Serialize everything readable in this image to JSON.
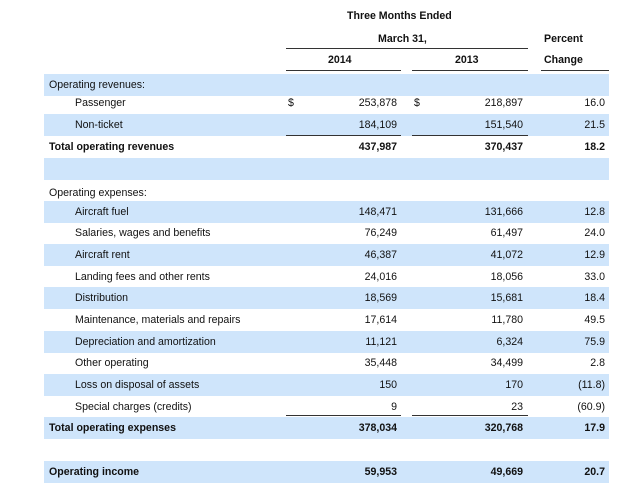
{
  "header": {
    "period_line1": "Three Months Ended",
    "period_line2": "March 31,",
    "col_2014": "2014",
    "col_2013": "2013",
    "pct_line1": "Percent",
    "pct_line2": "Change"
  },
  "rows": [
    {
      "label": "Operating revenues:",
      "indent": false,
      "bold": false,
      "shade": true,
      "dollar14": "",
      "dollar13": "",
      "v2014": "",
      "v2013": "",
      "pct": ""
    },
    {
      "label": "Passenger",
      "indent": true,
      "bold": false,
      "shade": false,
      "dollar14": "$",
      "dollar13": "$",
      "v2014": "253,878",
      "v2013": "218,897",
      "pct": "16.0"
    },
    {
      "label": "Non-ticket",
      "indent": true,
      "bold": false,
      "shade": true,
      "dollar14": "",
      "dollar13": "",
      "v2014": "184,109",
      "v2013": "151,540",
      "pct": "21.5"
    },
    {
      "label": "Total operating revenues",
      "indent": false,
      "bold": true,
      "shade": false,
      "dollar14": "",
      "dollar13": "",
      "v2014": "437,987",
      "v2013": "370,437",
      "pct": "18.2"
    },
    {
      "label": "",
      "indent": false,
      "bold": false,
      "shade": true,
      "dollar14": "",
      "dollar13": "",
      "v2014": "",
      "v2013": "",
      "pct": ""
    },
    {
      "label": "Operating expenses:",
      "indent": false,
      "bold": false,
      "shade": false,
      "dollar14": "",
      "dollar13": "",
      "v2014": "",
      "v2013": "",
      "pct": ""
    },
    {
      "label": "Aircraft fuel",
      "indent": true,
      "bold": false,
      "shade": true,
      "dollar14": "",
      "dollar13": "",
      "v2014": "148,471",
      "v2013": "131,666",
      "pct": "12.8"
    },
    {
      "label": "Salaries, wages and benefits",
      "indent": true,
      "bold": false,
      "shade": false,
      "dollar14": "",
      "dollar13": "",
      "v2014": "76,249",
      "v2013": "61,497",
      "pct": "24.0"
    },
    {
      "label": "Aircraft rent",
      "indent": true,
      "bold": false,
      "shade": true,
      "dollar14": "",
      "dollar13": "",
      "v2014": "46,387",
      "v2013": "41,072",
      "pct": "12.9"
    },
    {
      "label": "Landing fees and other rents",
      "indent": true,
      "bold": false,
      "shade": false,
      "dollar14": "",
      "dollar13": "",
      "v2014": "24,016",
      "v2013": "18,056",
      "pct": "33.0"
    },
    {
      "label": "Distribution",
      "indent": true,
      "bold": false,
      "shade": true,
      "dollar14": "",
      "dollar13": "",
      "v2014": "18,569",
      "v2013": "15,681",
      "pct": "18.4"
    },
    {
      "label": "Maintenance, materials and repairs",
      "indent": true,
      "bold": false,
      "shade": false,
      "dollar14": "",
      "dollar13": "",
      "v2014": "17,614",
      "v2013": "11,780",
      "pct": "49.5"
    },
    {
      "label": "Depreciation and amortization",
      "indent": true,
      "bold": false,
      "shade": true,
      "dollar14": "",
      "dollar13": "",
      "v2014": "11,121",
      "v2013": "6,324",
      "pct": "75.9"
    },
    {
      "label": "Other operating",
      "indent": true,
      "bold": false,
      "shade": false,
      "dollar14": "",
      "dollar13": "",
      "v2014": "35,448",
      "v2013": "34,499",
      "pct": "2.8"
    },
    {
      "label": "Loss on disposal of assets",
      "indent": true,
      "bold": false,
      "shade": true,
      "dollar14": "",
      "dollar13": "",
      "v2014": "150",
      "v2013": "170",
      "pct": "(11.8)"
    },
    {
      "label": "Special charges (credits)",
      "indent": true,
      "bold": false,
      "shade": false,
      "dollar14": "",
      "dollar13": "",
      "v2014": "9",
      "v2013": "23",
      "pct": "(60.9)"
    },
    {
      "label": "Total operating expenses",
      "indent": false,
      "bold": true,
      "shade": true,
      "dollar14": "",
      "dollar13": "",
      "v2014": "378,034",
      "v2013": "320,768",
      "pct": "17.9"
    },
    {
      "label": "",
      "indent": false,
      "bold": false,
      "shade": false,
      "dollar14": "",
      "dollar13": "",
      "v2014": "",
      "v2013": "",
      "pct": ""
    },
    {
      "label": "Operating income",
      "indent": false,
      "bold": true,
      "shade": true,
      "dollar14": "",
      "dollar13": "",
      "v2014": "59,953",
      "v2013": "49,669",
      "pct": "20.7"
    }
  ]
}
